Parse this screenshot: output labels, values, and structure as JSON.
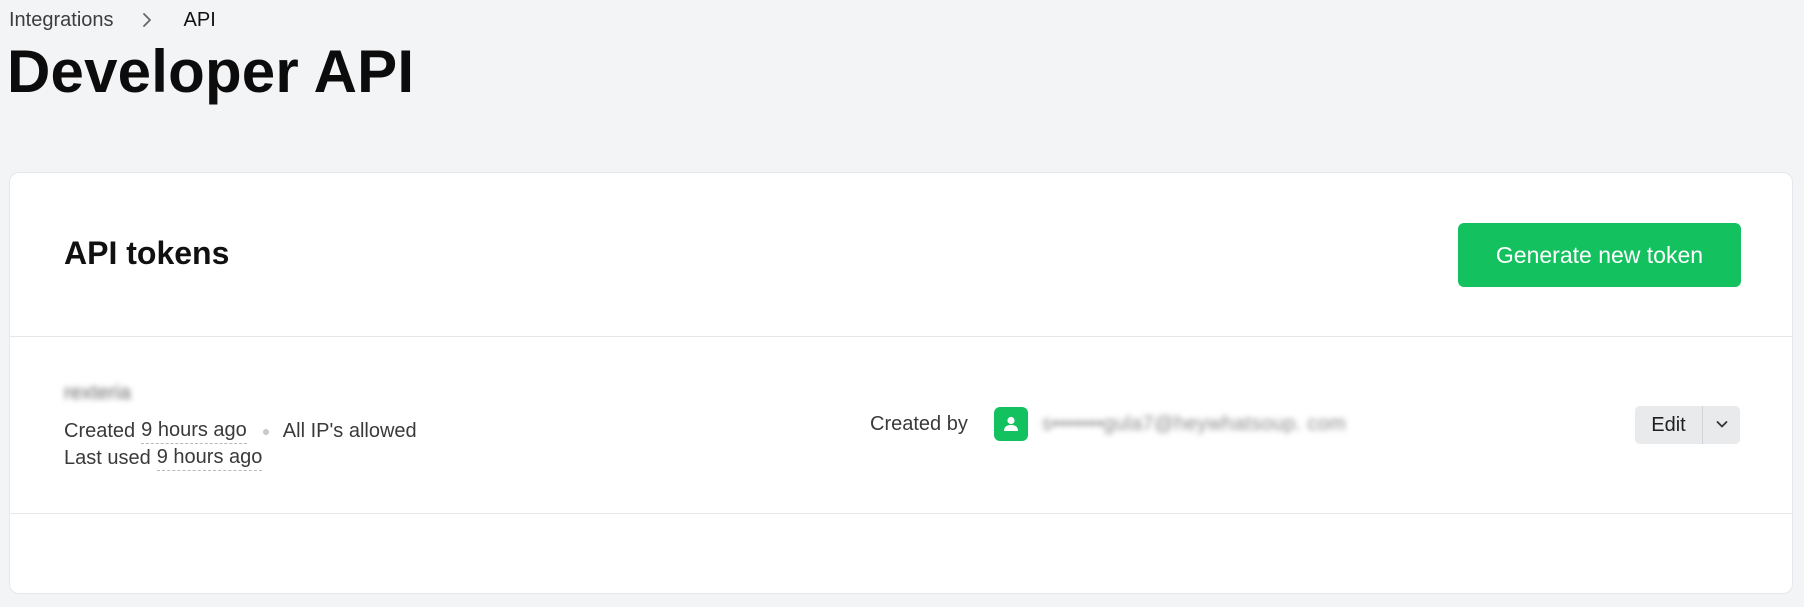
{
  "breadcrumb": {
    "parent": "Integrations",
    "current": "API",
    "separator_icon": "chevron-right-icon"
  },
  "page": {
    "title": "Developer API"
  },
  "tokens_card": {
    "title": "API tokens",
    "generate_button_label": "Generate new token",
    "accent_color": "#14c15f"
  },
  "tokens": [
    {
      "name": "rexteria",
      "created_label": "Created",
      "created_value": "9 hours ago",
      "ip_access": "All IP's allowed",
      "last_used_label": "Last used",
      "last_used_value": "9 hours ago",
      "created_by_label": "Created by",
      "creator_icon": "user-icon",
      "creator_email": "s•••••••gula7@heywhatsoup. com",
      "edit_label": "Edit",
      "more_icon": "chevron-down-icon"
    }
  ]
}
